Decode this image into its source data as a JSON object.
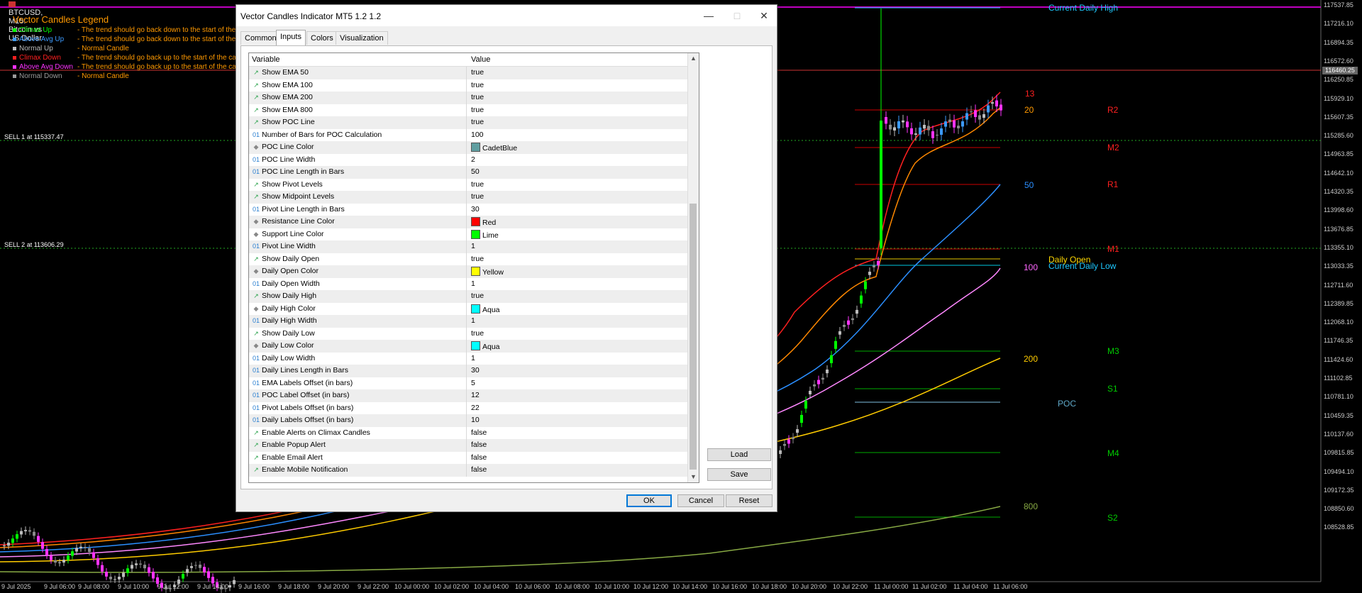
{
  "chart_header": {
    "symbol": "BTCUSD, M15: Bitcoin vs US Dollar",
    "legend_title": "Vector Candles Legend",
    "legend_rows": [
      {
        "name": "Climax Up",
        "color": "#00ff00",
        "desc": "- The trend should go back down to the start of the ca"
      },
      {
        "name": "Above Avg Up",
        "color": "#3d9bff",
        "desc": "- The trend should go back down to the start of the ca"
      },
      {
        "name": "Normal Up",
        "color": "#bdbdbd",
        "desc": "- Normal Candle"
      },
      {
        "name": "Climax Down",
        "color": "#ff2020",
        "desc": "- The trend should go back up to the start of the candl"
      },
      {
        "name": "Above Avg Down",
        "color": "#ff33ff",
        "desc": "- The trend should go back up to the start of the candl"
      },
      {
        "name": "Normal Down",
        "color": "#9a9a9a",
        "desc": "- Normal Candle"
      }
    ],
    "orders": [
      "SELL 1 at 115337.47",
      "SELL 2 at 113606.29"
    ]
  },
  "dialog": {
    "title": "Vector Candles Indicator MT5 1.2 1.2",
    "tabs": [
      "Common",
      "Inputs",
      "Colors",
      "Visualization"
    ],
    "active_tab": "Inputs",
    "col_variable": "Variable",
    "col_value": "Value",
    "rows": [
      {
        "icon": "bool",
        "name": "Show EMA 50",
        "value": "true"
      },
      {
        "icon": "bool",
        "name": "Show EMA 100",
        "value": "true"
      },
      {
        "icon": "bool",
        "name": "Show EMA 200",
        "value": "true"
      },
      {
        "icon": "bool",
        "name": "Show EMA 800",
        "value": "true"
      },
      {
        "icon": "bool",
        "name": "Show POC Line",
        "value": "true"
      },
      {
        "icon": "int",
        "name": "Number of Bars for POC Calculation",
        "value": "100"
      },
      {
        "icon": "color",
        "name": "POC Line Color",
        "value": "CadetBlue",
        "swatch": "#5f9ea0"
      },
      {
        "icon": "int",
        "name": "POC Line Width",
        "value": "2"
      },
      {
        "icon": "int",
        "name": "POC Line Length in Bars",
        "value": "50"
      },
      {
        "icon": "bool",
        "name": "Show Pivot Levels",
        "value": "true"
      },
      {
        "icon": "bool",
        "name": "Show Midpoint Levels",
        "value": "true"
      },
      {
        "icon": "int",
        "name": "Pivot Line Length in Bars",
        "value": "30"
      },
      {
        "icon": "color",
        "name": "Resistance Line Color",
        "value": "Red",
        "swatch": "#ff0000"
      },
      {
        "icon": "color",
        "name": "Support Line Color",
        "value": "Lime",
        "swatch": "#00ff00"
      },
      {
        "icon": "int",
        "name": "Pivot Line Width",
        "value": "1"
      },
      {
        "icon": "bool",
        "name": "Show Daily Open",
        "value": "true"
      },
      {
        "icon": "color",
        "name": "Daily Open Color",
        "value": "Yellow",
        "swatch": "#ffff00"
      },
      {
        "icon": "int",
        "name": "Daily Open Width",
        "value": "1"
      },
      {
        "icon": "bool",
        "name": "Show Daily High",
        "value": "true"
      },
      {
        "icon": "color",
        "name": "Daily High Color",
        "value": "Aqua",
        "swatch": "#00ffff"
      },
      {
        "icon": "int",
        "name": "Daily High Width",
        "value": "1"
      },
      {
        "icon": "bool",
        "name": "Show Daily Low",
        "value": "true"
      },
      {
        "icon": "color",
        "name": "Daily Low Color",
        "value": "Aqua",
        "swatch": "#00ffff"
      },
      {
        "icon": "int",
        "name": "Daily Low Width",
        "value": "1"
      },
      {
        "icon": "int",
        "name": "Daily Lines Length in Bars",
        "value": "30"
      },
      {
        "icon": "int",
        "name": "EMA Labels Offset (in bars)",
        "value": "5"
      },
      {
        "icon": "int",
        "name": "POC Label Offset (in bars)",
        "value": "12"
      },
      {
        "icon": "int",
        "name": "Pivot Labels Offset (in bars)",
        "value": "22"
      },
      {
        "icon": "int",
        "name": "Daily Labels Offset (in bars)",
        "value": "10"
      },
      {
        "icon": "bool",
        "name": "Enable Alerts on Climax Candles",
        "value": "false"
      },
      {
        "icon": "bool",
        "name": "Enable Popup Alert",
        "value": "false"
      },
      {
        "icon": "bool",
        "name": "Enable Email Alert",
        "value": "false"
      },
      {
        "icon": "bool",
        "name": "Enable Mobile Notification",
        "value": "false"
      }
    ],
    "buttons": {
      "load": "Load",
      "save": "Save",
      "ok": "OK",
      "cancel": "Cancel",
      "reset": "Reset"
    }
  },
  "chart_labels": {
    "current_daily_high": "Current Daily High",
    "daily_open": "Daily Open",
    "current_daily_low": "Current Daily Low",
    "poc": "POC",
    "ema_labels": [
      "13",
      "20",
      "50",
      "100",
      "200",
      "800"
    ],
    "pivots": [
      "R2",
      "M2",
      "R1",
      "M1",
      "M3",
      "S1",
      "M4",
      "S2"
    ]
  },
  "price_axis": [
    "117537.85",
    "117216.10",
    "116894.35",
    "116572.60",
    "116250.85",
    "115929.10",
    "115607.35",
    "115285.60",
    "114963.85",
    "114642.10",
    "114320.35",
    "113998.60",
    "113676.85",
    "113355.10",
    "113033.35",
    "112711.60",
    "112389.85",
    "112068.10",
    "111746.35",
    "111424.60",
    "111102.85",
    "110781.10",
    "110459.35",
    "110137.60",
    "109815.85",
    "109494.10",
    "109172.35",
    "108850.60",
    "108528.85"
  ],
  "current_price": "116460.25",
  "time_axis": [
    "9 Jul 2025",
    "9 Jul 06:00",
    "9 Jul 08:00",
    "9 Jul 10:00",
    "9 Jul 12:00",
    "9 Jul 14:00",
    "9 Jul 16:00",
    "9 Jul 18:00",
    "9 Jul 20:00",
    "9 Jul 22:00",
    "10 Jul 00:00",
    "10 Jul 02:00",
    "10 Jul 04:00",
    "10 Jul 06:00",
    "10 Jul 08:00",
    "10 Jul 10:00",
    "10 Jul 12:00",
    "10 Jul 14:00",
    "10 Jul 16:00",
    "10 Jul 18:00",
    "10 Jul 20:00",
    "10 Jul 22:00",
    "11 Jul 00:00",
    "11 Jul 02:00",
    "11 Jul 04:00",
    "11 Jul 06:00"
  ]
}
